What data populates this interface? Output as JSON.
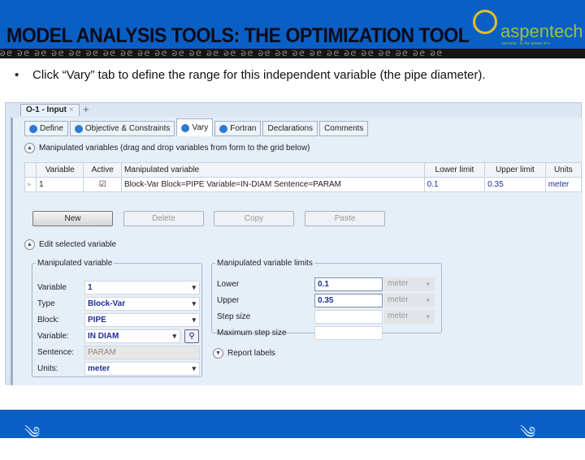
{
  "slide": {
    "title": "MODEL ANALYSIS TOOLS: THE OPTIMIZATION TOOL",
    "bullet": "Click “Vary” tab to define the range for this independent variable (the pipe diameter).",
    "logo_text": "aspentech",
    "logo_tagline": "process . to the power of e",
    "ornament": "ᘐᘓ ᘐᘓ ᘐᘓ ᘐᘓ ᘐᘓ ᘐᘓ ᘐᘓ ᘐᘓ ᘐᘓ ᘐᘓ ᘐᘓ ᘐᘓ ᘐᘓ ᘐᘓ ᘐᘓ ᘐᘓ ᘐᘓ ᘐᘓ ᘐᘓ ᘐᘓ ᘐᘓ ᘐᘓ ᘐᘓ ᘐᘓ ᘐᘓ ᘐᘓ",
    "footer_ornament": "༄"
  },
  "app": {
    "doc_tab": "O-1 - Input",
    "doc_tab_close": "×",
    "new_tab": "+",
    "tabs": [
      {
        "label": "Define",
        "check": true
      },
      {
        "label": "Objective & Constraints",
        "check": true
      },
      {
        "label": "Vary",
        "check": true
      },
      {
        "label": "Fortran",
        "check": true
      },
      {
        "label": "Declarations",
        "check": false
      },
      {
        "label": "Comments",
        "check": false
      }
    ],
    "grid_section": "Manipulated variables (drag and drop variables from form to the grid below)",
    "grid": {
      "headers": [
        "Variable",
        "Active",
        "Manipulated variable",
        "Lower limit",
        "Upper limit",
        "Units"
      ],
      "row": {
        "variable": "1",
        "active": true,
        "manipulated": "Block-Var Block=PIPE Variable=IN-DIAM Sentence=PARAM",
        "lower": "0.1",
        "upper": "0.35",
        "units": "meter"
      }
    },
    "buttons": {
      "new": "New",
      "delete": "Delete",
      "copy": "Copy",
      "paste": "Paste"
    },
    "edit_section": "Edit selected variable",
    "mv": {
      "legend": "Manipulated variable",
      "fields": [
        {
          "label": "Variable",
          "value": "1"
        },
        {
          "label": "Type",
          "value": "Block-Var"
        },
        {
          "label": "Block:",
          "value": "PIPE"
        },
        {
          "label": "Variable:",
          "value": "IN DIAM"
        },
        {
          "label": "Sentence:",
          "value": "PARAM"
        },
        {
          "label": "Units:",
          "value": "meter"
        }
      ]
    },
    "limits": {
      "legend": "Manipulated variable limits",
      "lower_label": "Lower",
      "lower": "0.1",
      "upper_label": "Upper",
      "upper": "0.35",
      "step_label": "Step size",
      "max_step_label": "Maximum step size",
      "unit": "meter"
    },
    "report_labels": "Report labels"
  },
  "colors": {
    "brand_blue": "#0a5fc4",
    "value_blue": "#1d2f9c"
  }
}
